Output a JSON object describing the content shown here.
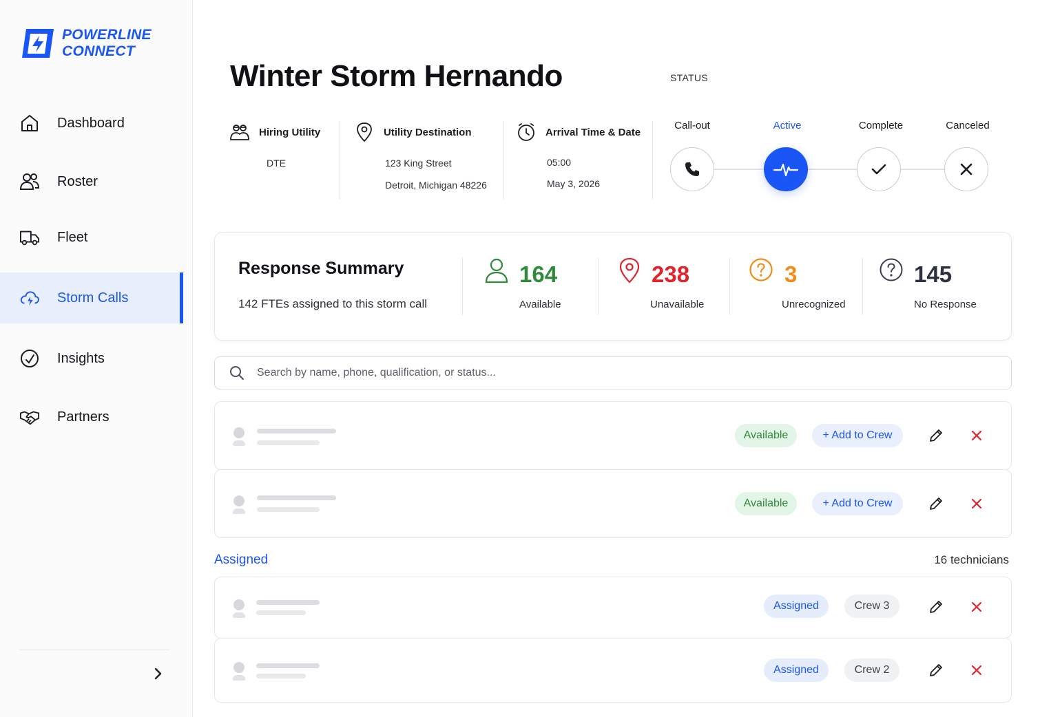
{
  "app": {
    "logo_line1": "POWERLINE",
    "logo_line2": "CONNECT",
    "brand_color": "#1a56f5"
  },
  "sidebar": {
    "items": [
      {
        "label": "Dashboard",
        "icon": "home-icon"
      },
      {
        "label": "Roster",
        "icon": "users-icon"
      },
      {
        "label": "Fleet",
        "icon": "truck-icon"
      },
      {
        "label": "Storm Calls",
        "icon": "storm-cloud-icon",
        "active": true
      },
      {
        "label": "Insights",
        "icon": "gauge-icon"
      },
      {
        "label": "Partners",
        "icon": "handshake-icon"
      }
    ],
    "collapse_icon": "chevron-right-icon"
  },
  "header": {
    "title": "Winter Storm Hernando",
    "status_label": "STATUS"
  },
  "info": {
    "hiring_utility_label": "Hiring Utility",
    "hiring_utility_value": "DTE",
    "destination_label": "Utility Destination",
    "destination_line1": "123 King Street",
    "destination_line2": "Detroit, Michigan 48226",
    "arrival_label": "Arrival Time & Date",
    "arrival_time": "05:00",
    "arrival_date": "May 3, 2026"
  },
  "status_steps": [
    {
      "label": "Call-out",
      "icon": "phone-icon",
      "active": false
    },
    {
      "label": "Active",
      "icon": "pulse-icon",
      "active": true
    },
    {
      "label": "Complete",
      "icon": "check-icon",
      "active": false
    },
    {
      "label": "Canceled",
      "icon": "x-icon",
      "active": false
    }
  ],
  "summary": {
    "title": "Response Summary",
    "subtitle": "142 FTEs assigned to this storm call",
    "stats": [
      {
        "value": "164",
        "label": "Available",
        "color": "#2f8a3a",
        "icon": "user-icon"
      },
      {
        "value": "238",
        "label": "Unavailable",
        "color": "#e0242b",
        "icon": "map-pin-icon"
      },
      {
        "value": "3",
        "label": "Unrecognized",
        "color": "#f08c1a",
        "icon": "question-circle-icon"
      },
      {
        "value": "145",
        "label": "No Response",
        "color": "#2c3140",
        "icon": "question-circle-icon"
      }
    ]
  },
  "search": {
    "placeholder": "Search by name, phone, qualification, or status..."
  },
  "available_rows": [
    {
      "status": "Available",
      "action": "+ Add to Crew"
    },
    {
      "status": "Available",
      "action": "+ Add to Crew"
    }
  ],
  "assigned_section": {
    "heading": "Assigned",
    "count": "16 technicians"
  },
  "assigned_rows": [
    {
      "status": "Assigned",
      "crew": "Crew 3"
    },
    {
      "status": "Assigned",
      "crew": "Crew 2"
    }
  ]
}
